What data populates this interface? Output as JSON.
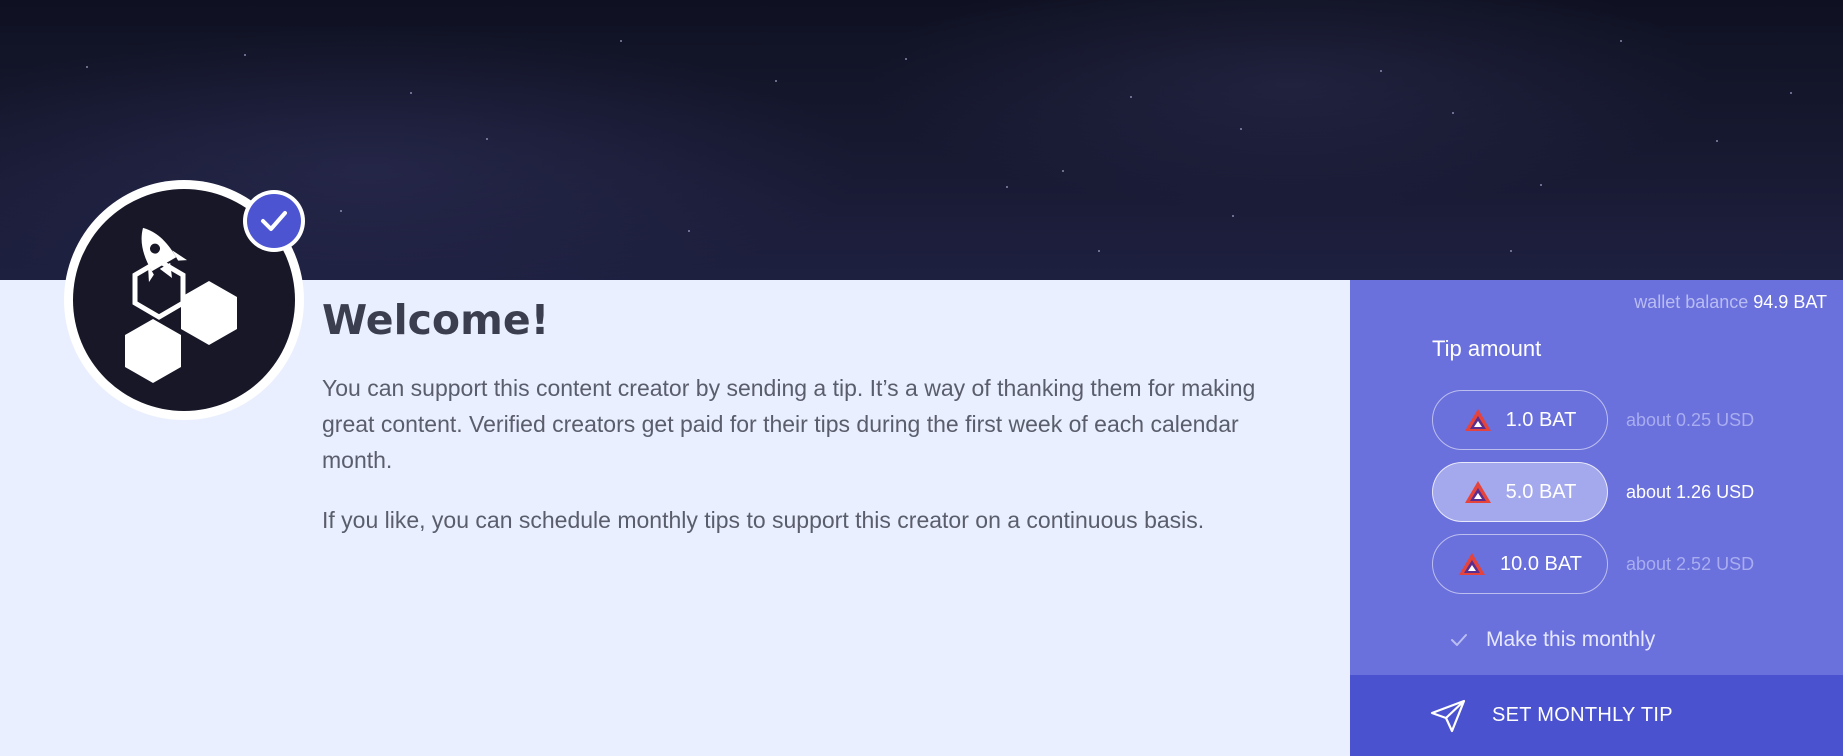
{
  "welcome": {
    "title": "Welcome!",
    "paragraph1": "You can support this content creator by sending a tip. It’s a way of thanking them for making great content. Verified creators get paid for their tips during the first week of each calendar month.",
    "paragraph2": "If you like, you can schedule monthly tips to support this creator on a continuous basis."
  },
  "wallet": {
    "label": "wallet balance",
    "amount": "94.9 BAT"
  },
  "tip": {
    "label": "Tip amount",
    "options": [
      {
        "amount": "1.0 BAT",
        "usd": "about 0.25 USD",
        "selected": false
      },
      {
        "amount": "5.0 BAT",
        "usd": "about 1.26 USD",
        "selected": true
      },
      {
        "amount": "10.0 BAT",
        "usd": "about 2.52 USD",
        "selected": false
      }
    ],
    "monthly_label": "Make this monthly",
    "monthly_checked": true
  },
  "action": {
    "button_label": "SET MONTHLY TIP"
  },
  "icons": {
    "verified": "check-icon",
    "token": "bat-token-icon",
    "send": "send-icon",
    "avatar": "rocket-hexagon-icon"
  },
  "colors": {
    "panel": "#6a70dc",
    "footer": "#4b52d0",
    "verified": "#4c54d2",
    "content_bg": "#e9effe"
  }
}
